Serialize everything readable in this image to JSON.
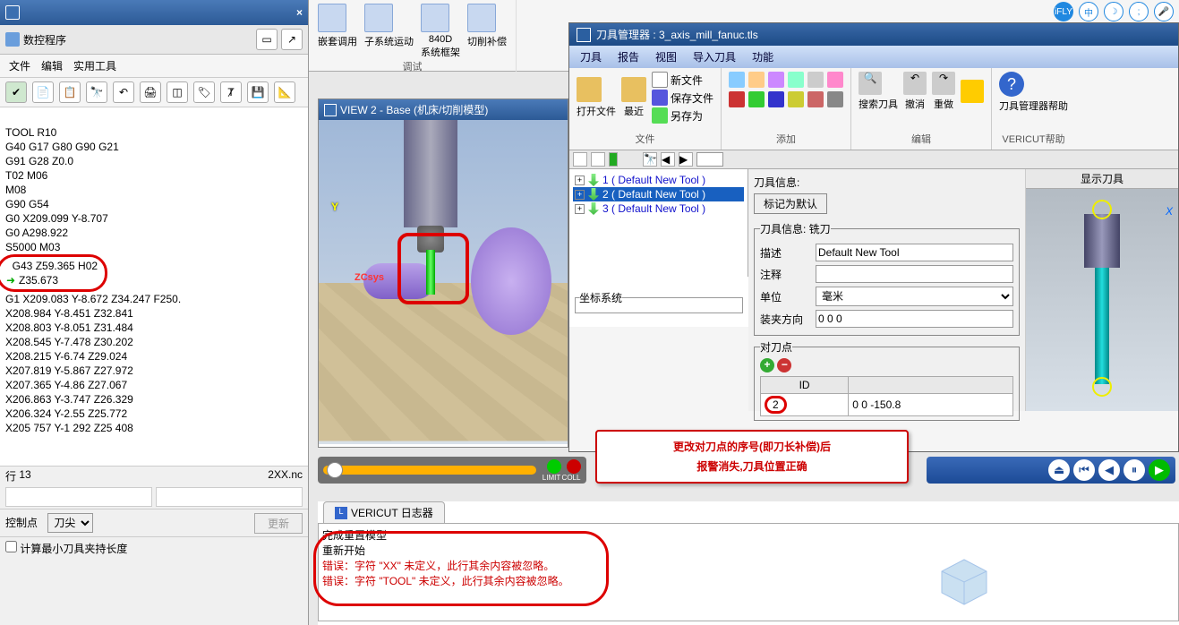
{
  "left": {
    "panel_title": "数控程序",
    "menu": {
      "file": "文件",
      "edit": "编辑",
      "tools": "实用工具"
    },
    "code_lines": [
      "TOOL R10",
      "G40 G17 G80 G90 G21",
      "G91 G28 Z0.0",
      "T02 M06",
      "M08",
      "G90 G54",
      "G0 X209.099 Y-8.707",
      "G0 A298.922",
      "S5000 M03"
    ],
    "highlight_lines": [
      "G43 Z59.365 H02",
      "Z35.673"
    ],
    "code_lines2": [
      "G1 X209.083 Y-8.672 Z34.247 F250.",
      "X208.984 Y-8.451 Z32.841",
      "X208.803 Y-8.051 Z31.484",
      "X208.545 Y-7.478 Z30.202",
      "X208.215 Y-6.74 Z29.024",
      "X207.819 Y-5.867 Z27.972",
      "X207.365 Y-4.86 Z27.067",
      "X206.863 Y-3.747 Z26.329",
      "X206.324 Y-2.55 Z25.772",
      "X205 757 Y-1 292 Z25 408"
    ],
    "status_line": {
      "label": "行",
      "value": "13",
      "file": "2XX.nc"
    },
    "control_point_label": "控制点",
    "control_point_value": "刀尖",
    "chk_label": "计算最小刀具夹持长度",
    "update_btn": "更新"
  },
  "ribbon": {
    "g1_items": [
      "嵌套调用",
      "子系统运动",
      "840D\n系统框架",
      "切削补偿"
    ],
    "g1_title": "调试"
  },
  "view": {
    "title": "VIEW 2 - Base (机床/切削模型)",
    "axis_y": "Y",
    "csys": "ZCsys"
  },
  "play": {
    "limit": "LIMIT",
    "coll": "COLL"
  },
  "log": {
    "tab": "VERICUT 日志器",
    "line1": "完成重置模型",
    "line2": "重新开始",
    "err1": "错误：字符 \"XX\" 未定义，此行其余内容被忽略。",
    "err2": "错误：字符 \"TOOL\" 未定义，此行其余内容被忽略。"
  },
  "tm": {
    "title": "刀具管理器 : 3_axis_mill_fanuc.tls",
    "menu": {
      "tool": "刀具",
      "report": "报告",
      "view": "视图",
      "import": "导入刀具",
      "func": "功能"
    },
    "grp_file": {
      "open": "打开文件",
      "recent": "最近",
      "new": "新文件",
      "save": "保存文件",
      "saveas": "另存为",
      "title": "文件"
    },
    "grp_add": "添加",
    "grp_edit": {
      "search": "搜索刀具",
      "undo": "撤消",
      "redo": "重做",
      "title": "编辑"
    },
    "grp_help": {
      "mgr_help": "刀具管理器帮助",
      "vhelp": "VERICUT帮助"
    },
    "tree": {
      "n1": "1 ( Default New Tool )",
      "n2": "2 ( Default New Tool )",
      "n3": "3 ( Default New Tool )"
    },
    "coords_legend": "坐标系统",
    "info": {
      "header": "刀具信息:",
      "mark_default": "标记为默认",
      "legend": "刀具信息: 铣刀",
      "desc_label": "描述",
      "desc_value": "Default New Tool",
      "note_label": "注释",
      "unit_label": "单位",
      "unit_value": "毫米",
      "orient_label": "装夹方向",
      "orient_value": "0 0 0",
      "gauge_legend": "对刀点",
      "id_header": "ID",
      "offset_header": " ",
      "id_value": "2",
      "offset_value": "0 0 -150.8"
    },
    "display_title": "显示刀具",
    "axis_x": "X"
  },
  "annotation": {
    "l1": "更改对刀点的序号(即刀长补偿)后",
    "l2": "报警消失,刀具位置正确"
  },
  "float": {
    "ifly": "iFLY",
    "zh": "中"
  }
}
